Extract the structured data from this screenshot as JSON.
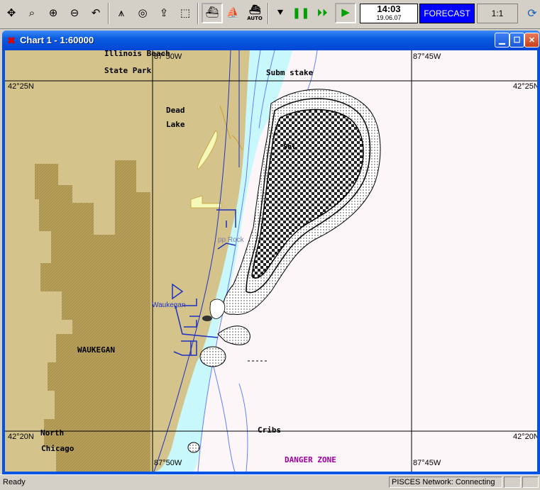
{
  "toolbar": {
    "icons": [
      "fit-icon",
      "zoom-window-icon",
      "zoom-in-icon",
      "zoom-out-icon",
      "undo-icon",
      "compass-icon",
      "target-icon",
      "export-icon",
      "import-icon",
      "ship-icon",
      "ship-outline-icon",
      "ship-auto-icon",
      "down-arrow-icon",
      "pause-icon",
      "fast-forward-icon",
      "play-icon",
      "globe-icon"
    ],
    "auto_label": "AUTO",
    "time": "14:03",
    "date": "19.06.07",
    "forecast_label": "FORECAST",
    "scale_label": "1:1"
  },
  "window": {
    "title": "Chart 1 - 1:60000"
  },
  "chart": {
    "labels": {
      "illinois_beach": "Illinois Beach",
      "state_park": "State Park",
      "subm_stake": "Subm stake",
      "dead": "Dead",
      "lake": "Lake",
      "waukegan_town": "WAUKEGAN",
      "waukegan_harbor": "Waukegan",
      "north": "North",
      "chicago": "Chicago",
      "cribs": "Cribs",
      "danger_zone": "DANGER ZONE",
      "pp_rock": "pp Rock",
      "shoal_label": "Shl"
    },
    "coords": {
      "lat_top_left": "42°25N",
      "lat_top_right": "42°25N",
      "lat_bottom_left": "42°20N",
      "lat_bottom_right": "42°20N",
      "lon_top_left": "87°50W",
      "lon_top_right": "87°45W",
      "lon_bottom_left": "87°50W",
      "lon_bottom_right": "87°45W"
    },
    "colors": {
      "land": "#d4c48c",
      "urban": "#b8a05a",
      "shallow_water": "#c8f8fc",
      "deep_water": "#fcf6f8",
      "contour": "#6080ff",
      "danger": "#a000a0"
    }
  },
  "status": {
    "ready": "Ready",
    "network": "PISCES Network: Connecting"
  }
}
